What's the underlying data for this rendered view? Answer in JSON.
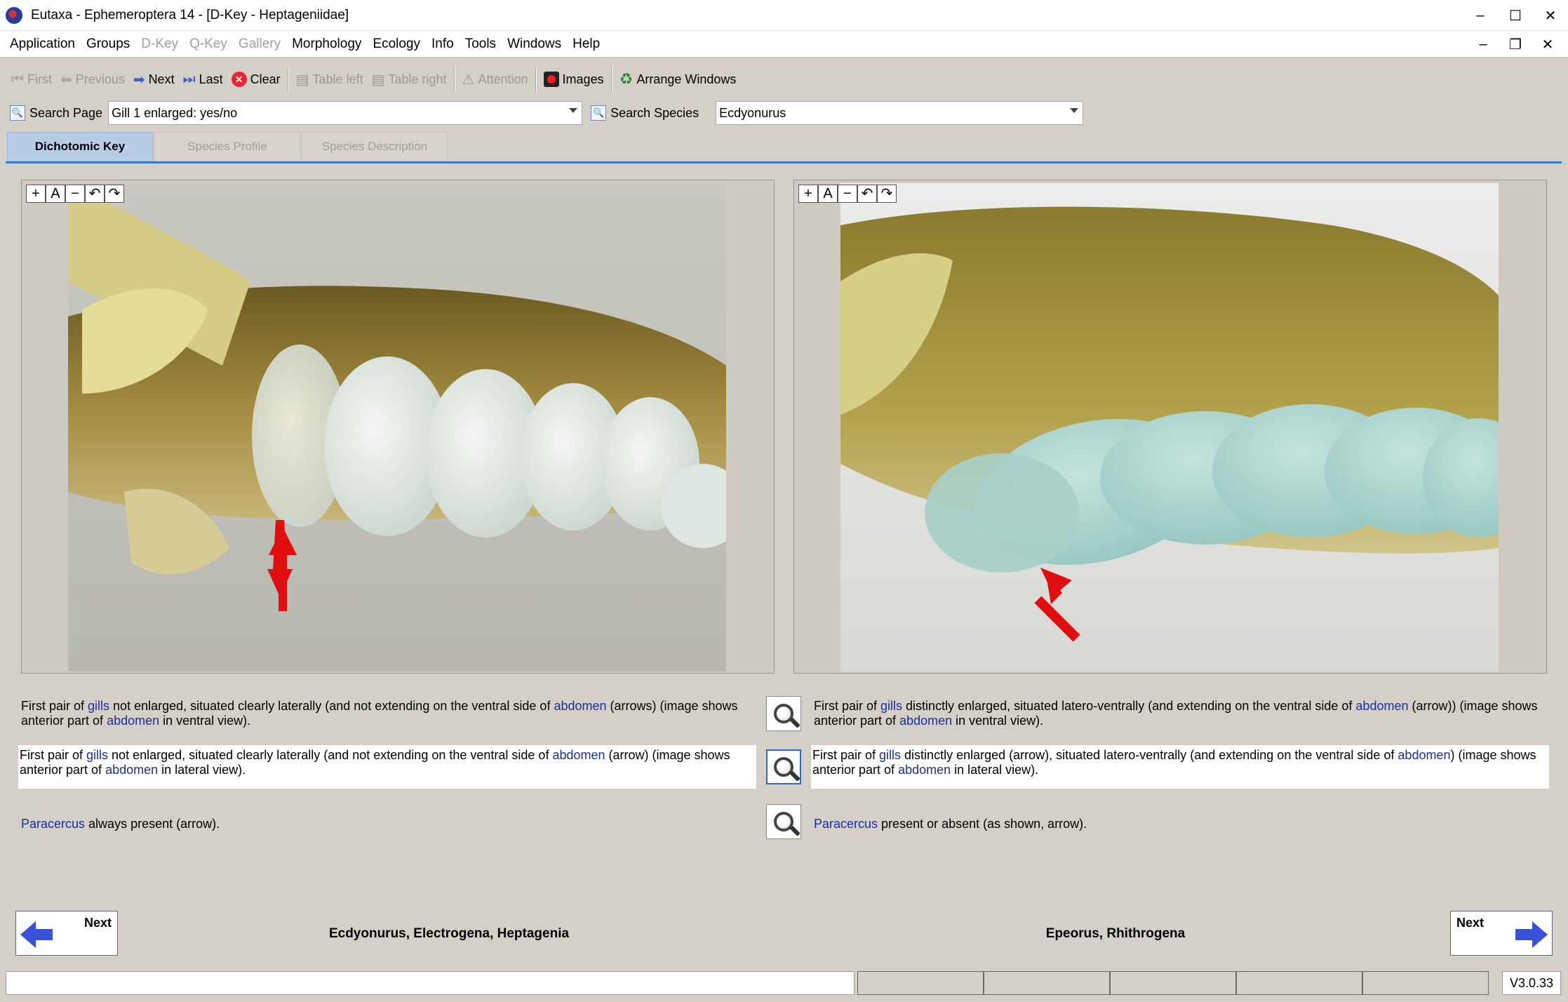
{
  "window": {
    "title": "Eutaxa - Ephemeroptera 14 - [D-Key - Heptageniidae]",
    "controls": [
      "–",
      "☐",
      "✕"
    ]
  },
  "menu": {
    "items": [
      {
        "label": "Application",
        "enabled": true
      },
      {
        "label": "Groups",
        "enabled": true
      },
      {
        "label": "D-Key",
        "enabled": false
      },
      {
        "label": "Q-Key",
        "enabled": false
      },
      {
        "label": "Gallery",
        "enabled": false
      },
      {
        "label": "Morphology",
        "enabled": true
      },
      {
        "label": "Ecology",
        "enabled": true
      },
      {
        "label": "Info",
        "enabled": true
      },
      {
        "label": "Tools",
        "enabled": true
      },
      {
        "label": "Windows",
        "enabled": true
      },
      {
        "label": "Help",
        "enabled": true
      }
    ]
  },
  "toolbar": {
    "first": "First",
    "previous": "Previous",
    "next": "Next",
    "last": "Last",
    "clear": "Clear",
    "table_left": "Table left",
    "table_right": "Table right",
    "attention": "Attention",
    "images": "Images",
    "arrange": "Arrange Windows"
  },
  "search": {
    "page_label": "Search Page",
    "page_value": "Gill 1 enlarged: yes/no",
    "species_label": "Search Species",
    "species_value": "Ecdyonurus"
  },
  "tabs": [
    {
      "label": "Dichotomic Key",
      "active": true
    },
    {
      "label": "Species Profile",
      "active": false
    },
    {
      "label": "Species Description",
      "active": false
    }
  ],
  "image_tools": [
    "+",
    "A",
    "−",
    "↶",
    "↷"
  ],
  "couplets": {
    "left": [
      {
        "t1": "First pair of ",
        "l1": "gills",
        "t2": " not enlarged, situated clearly laterally (and not extending on the ventral side of ",
        "l2": "abdomen",
        "t3": " (arrows) (image shows anterior part of ",
        "l3": "abdomen",
        "t4": " in ventral view)."
      },
      {
        "t1": "First pair of ",
        "l1": "gills",
        "t2": " not enlarged, situated clearly laterally (and not extending on the ventral side of ",
        "l2": "abdomen",
        "t3": " (arrow) (image shows anterior part of ",
        "l3": "abdomen",
        "t4": " in lateral view)."
      },
      {
        "l1": "Paracercus",
        "t2": " always present (arrow)."
      }
    ],
    "right": [
      {
        "t1": "First pair of ",
        "l1": "gills",
        "t2": " distinctly enlarged, situated latero-ventrally (and extending on the ventral side of ",
        "l2": "abdomen",
        "t3": " (arrow)) (image shows anterior part of ",
        "l3": "abdomen",
        "t4": " in ventral view)."
      },
      {
        "t1": "First pair of ",
        "l1": "gills",
        "t2": " distinctly enlarged (arrow), situated latero-ventrally (and extending on the ventral side of ",
        "l2": "abdomen",
        "t3": ") (image shows anterior part of ",
        "l3": "abdomen",
        "t4": " in lateral view)."
      },
      {
        "l1": "Paracercus",
        "t2": " present or absent (as shown, arrow)."
      }
    ]
  },
  "nav": {
    "left_next": "Next",
    "left_result": "Ecdyonurus, Electrogena, Heptagenia",
    "right_next": "Next",
    "right_result": "Epeorus, Rhithrogena"
  },
  "status": {
    "version": "V3.0.33"
  },
  "colors": {
    "link": "#1b2f9f",
    "arrow_red": "#e01010",
    "nav_arrow_blue": "#3a52d8",
    "tab_active": "#b7cde6"
  }
}
